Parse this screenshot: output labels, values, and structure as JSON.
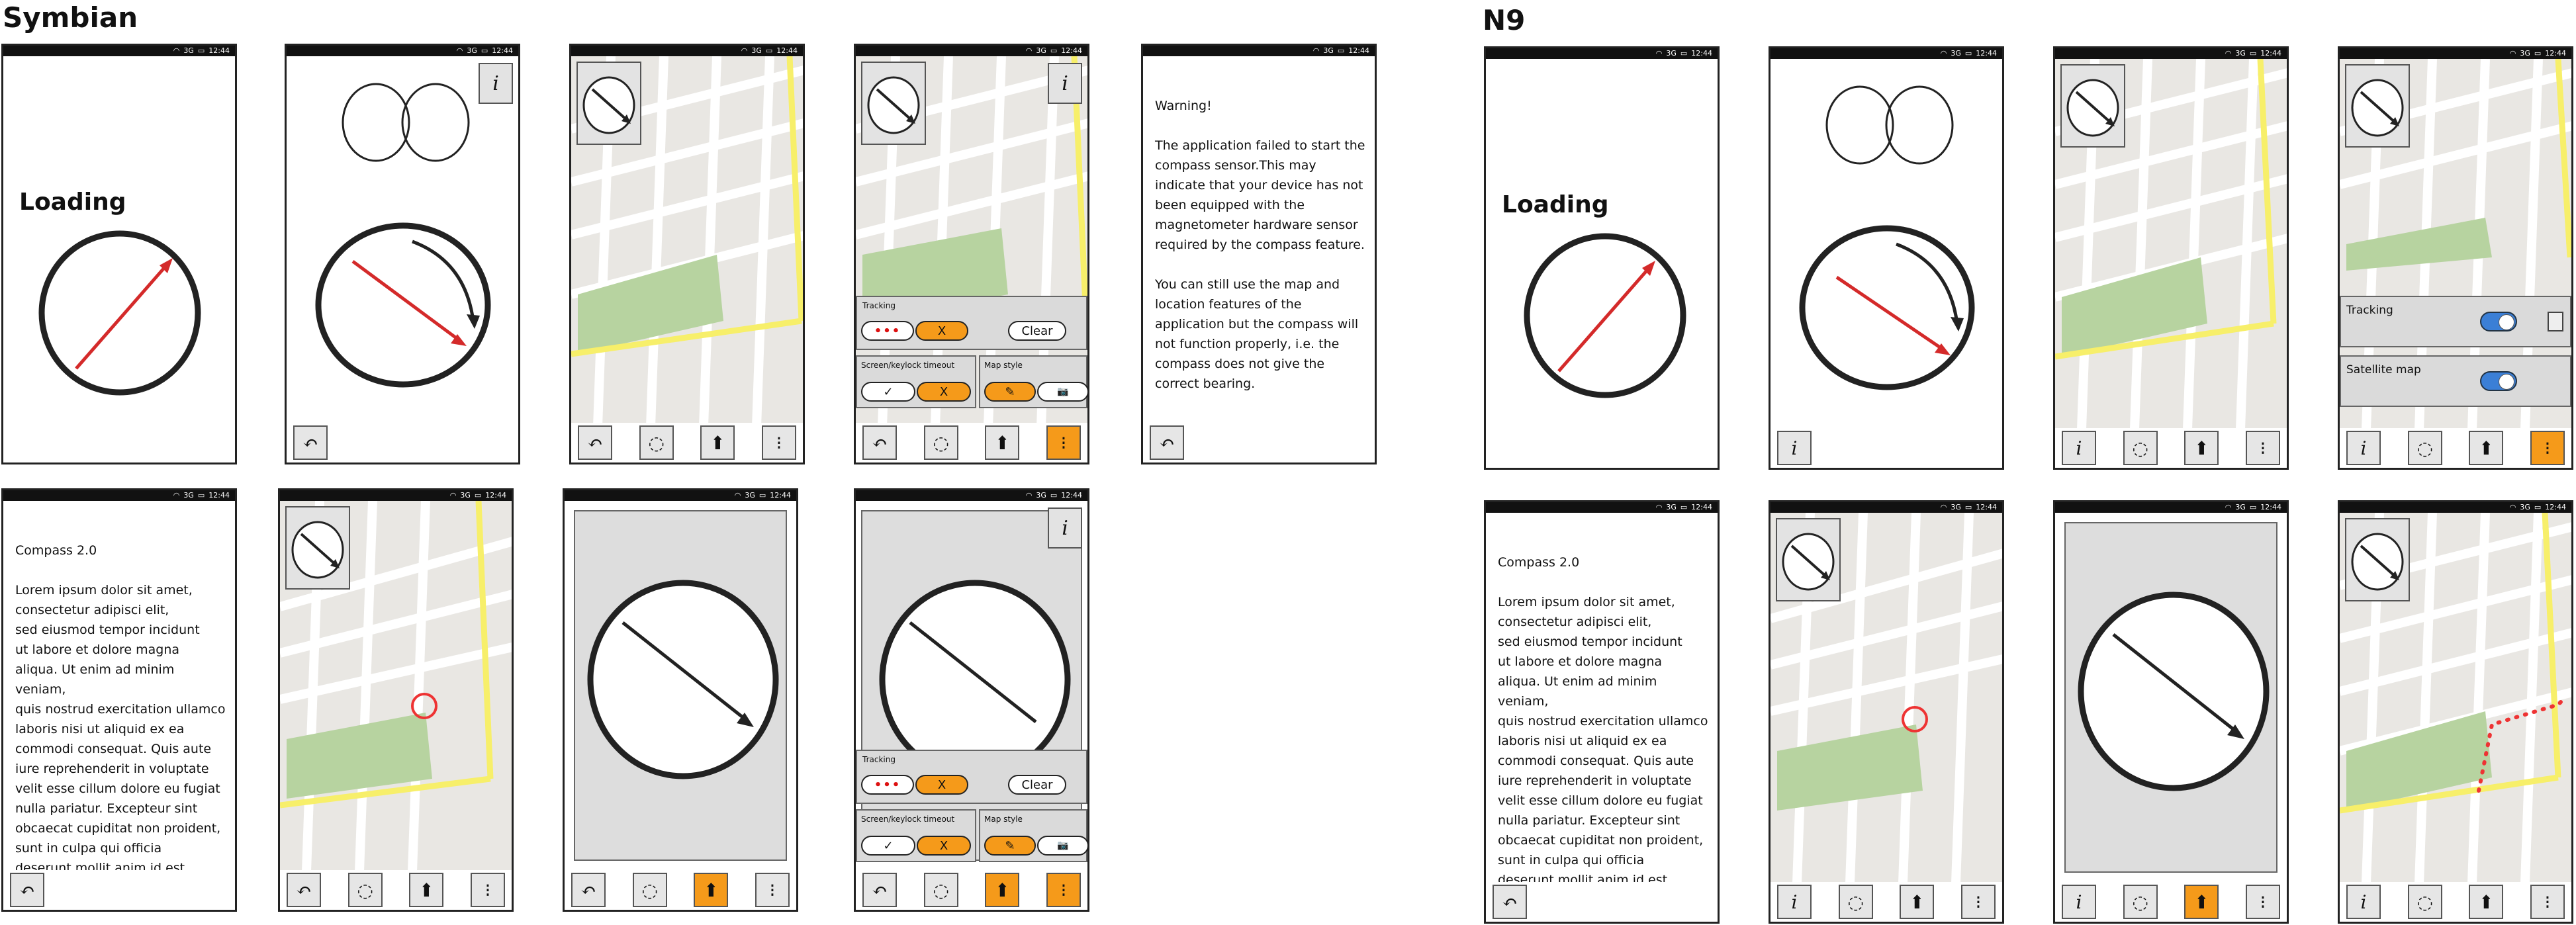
{
  "sections": {
    "symbian": "Symbian",
    "n9": "N9"
  },
  "status": {
    "wifi": "wifi-icon",
    "network": "3G",
    "battery": "battery-icon",
    "time": "12:44"
  },
  "screens": {
    "loading_label": "Loading",
    "info_icon": "i",
    "warning_text": "Warning!\n\nThe application failed to start the compass sensor.This may indicate that your device has not been equipped with the magnetometer hardware sensor required by the compass feature.\n\nYou can still use the map and location features of the application but the compass will not function properly, i.e. the compass does not give the correct bearing.",
    "about_title": "Compass 2.0",
    "about_body": "Lorem ipsum dolor sit amet,\nconsectetur adipisci elit,\nsed eiusmod tempor incidunt\nut labore et dolore magna\naliqua. Ut enim ad minim veniam,\nquis nostrud exercitation ullamco\nlaboris nisi ut aliquid ex ea\ncommodi consequat. Quis aute\niure reprehenderit in voluptate\nvelit esse cillum dolore eu fugiat\nnulla pariatur. Excepteur sint\nobcaecat cupiditat non proident,\nsunt in culpa qui officia\ndeserunt mollit anim id est\nlaborum."
  },
  "settings_panel": {
    "tracking_label": "Tracking",
    "tracking_dots": "•••",
    "tracking_x": "X",
    "clear_label": "Clear",
    "timeout_label": "Screen/keylock timeout",
    "check_label": "✓",
    "timeout_x": "X",
    "mapstyle_label": "Map style",
    "pencil_icon": "✎",
    "camera_icon": "📷"
  },
  "n9_settings": {
    "tracking_label": "Tracking",
    "satellite_label": "Satellite map"
  },
  "toolbar": {
    "back": "↶",
    "locate": "◌",
    "compass_mode": "⬆",
    "more": "⁝"
  },
  "colors": {
    "accent_orange": "#f59a1a",
    "arrow_red": "#d42a2a",
    "park_green": "#b7d3a0",
    "road_yellow": "#f7ef6a",
    "toggle_blue": "#3b7fd6"
  }
}
